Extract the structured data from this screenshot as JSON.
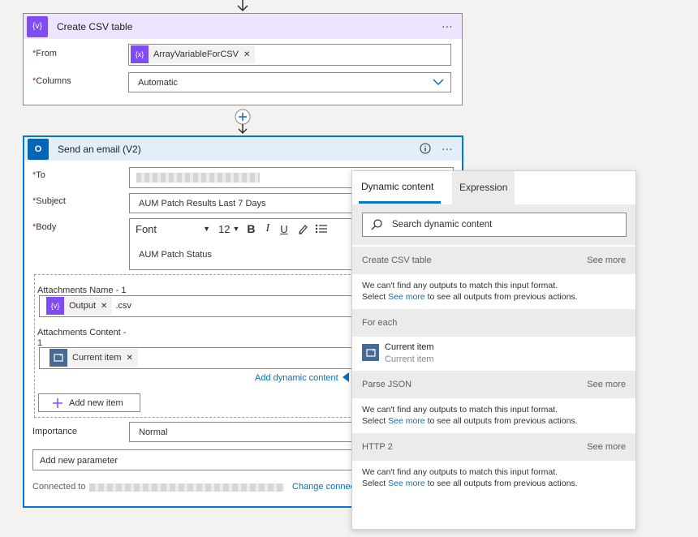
{
  "create_csv": {
    "title": "Create CSV table",
    "icon_label": "{v}",
    "from_label": "From",
    "from_token": "ArrayVariableForCSV",
    "from_token_icon": "{x}",
    "columns_label": "Columns",
    "columns_value": "Automatic"
  },
  "send_email": {
    "title": "Send an email (V2)",
    "to_label": "To",
    "subject_label": "Subject",
    "subject_value": "AUM Patch Results Last 7 Days",
    "body_label": "Body",
    "font_name": "Font",
    "font_size": "12",
    "bold": "B",
    "italic": "I",
    "underline": "U",
    "body_text": "AUM Patch Status",
    "att_name_label": "Attachments Name - 1",
    "att_name_token": "Output",
    "att_name_token_icon": "{v}",
    "att_name_suffix": ".csv",
    "att_content_label_1": "Attachments Content -",
    "att_content_label_2": "1",
    "att_content_token": "Current item",
    "add_dynamic_content": "Add dynamic content",
    "add_new_item": "Add new item",
    "importance_label": "Importance",
    "importance_value": "Normal",
    "add_param": "Add new parameter",
    "connected_to": "Connected to",
    "change_conn": "Change connec"
  },
  "panel": {
    "tab_dynamic": "Dynamic content",
    "tab_expression": "Expression",
    "search_placeholder": "Search dynamic content",
    "sections": {
      "csv": {
        "title": "Create CSV table",
        "see_more": "See more"
      },
      "foreach": {
        "title": "For each"
      },
      "json": {
        "title": "Parse JSON",
        "see_more": "See more"
      },
      "http": {
        "title": "HTTP 2",
        "see_more": "See more"
      }
    },
    "msg_line1": "We can't find any outputs to match this input format.",
    "msg_select": "Select",
    "msg_see_more": "See more",
    "msg_rest": "to see all outputs from previous actions.",
    "current_item_title": "Current item",
    "current_item_sub": "Current item"
  },
  "colors": {
    "accent": "#0078d4",
    "variables": "#7f4cf4",
    "control": "#486991",
    "outlook": "#0364b8"
  }
}
